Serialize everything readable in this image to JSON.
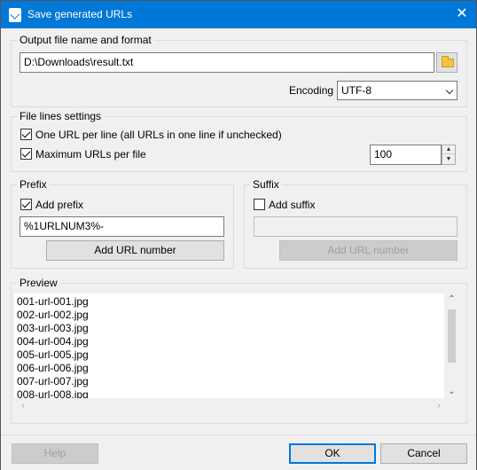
{
  "window": {
    "title": "Save generated URLs",
    "close_glyph": "✕"
  },
  "output": {
    "group_label": "Output file name and format",
    "path_value": "D:\\Downloads\\result.txt",
    "folder_icon": "folder-open-icon",
    "encoding_label": "Encoding",
    "encoding_value": "UTF-8"
  },
  "file_lines": {
    "group_label": "File lines settings",
    "one_url_label": "One URL per line (all URLs in one line if unchecked)",
    "one_url_checked": true,
    "max_urls_label": "Maximum URLs per file",
    "max_urls_checked": true,
    "max_urls_value": "100"
  },
  "prefix": {
    "group_label": "Prefix",
    "add_label": "Add prefix",
    "add_checked": true,
    "value": "%1URLNUM3%-",
    "button": "Add URL number"
  },
  "suffix": {
    "group_label": "Suffix",
    "add_label": "Add suffix",
    "add_checked": false,
    "value": "",
    "button": "Add URL number"
  },
  "preview": {
    "group_label": "Preview",
    "lines": [
      "001-url-001.jpg",
      "002-url-002.jpg",
      "003-url-003.jpg",
      "004-url-004.jpg",
      "005-url-005.jpg",
      "006-url-006.jpg",
      "007-url-007.jpg",
      "008-url-008.jpg"
    ]
  },
  "buttons": {
    "help": "Help",
    "ok": "OK",
    "cancel": "Cancel"
  },
  "colors": {
    "titlebar": "#0078d7",
    "accent": "#0078d7"
  }
}
